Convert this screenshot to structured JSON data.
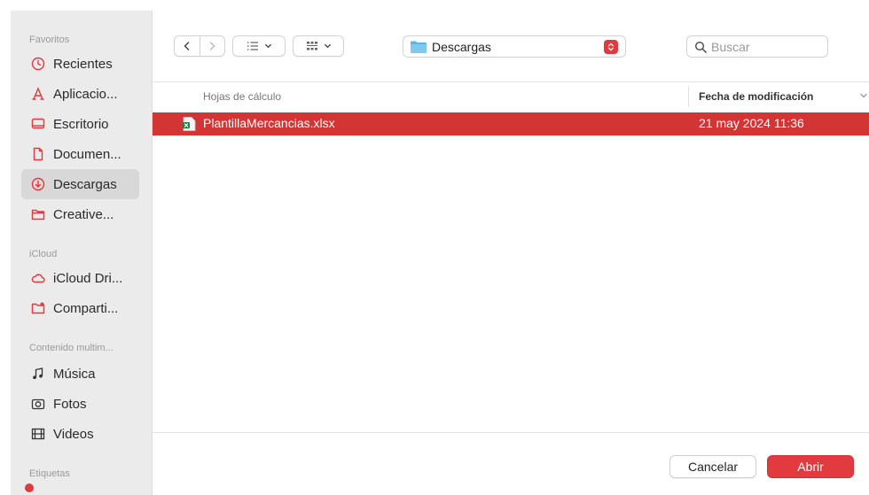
{
  "sidebar": {
    "sections": [
      {
        "title": "Favoritos",
        "items": [
          {
            "label": "Recientes",
            "icon": "clock-icon"
          },
          {
            "label": "Aplicacio...",
            "icon": "applications-icon"
          },
          {
            "label": "Escritorio",
            "icon": "desktop-icon"
          },
          {
            "label": "Documen...",
            "icon": "document-icon"
          },
          {
            "label": "Descargas",
            "icon": "download-icon",
            "active": true
          },
          {
            "label": "Creative...",
            "icon": "folder-icon"
          }
        ]
      },
      {
        "title": "iCloud",
        "items": [
          {
            "label": "iCloud Dri...",
            "icon": "cloud-icon"
          },
          {
            "label": "Comparti...",
            "icon": "shared-folder-icon"
          }
        ]
      },
      {
        "title": "Contenido multim...",
        "items": [
          {
            "label": "Música",
            "icon": "music-icon"
          },
          {
            "label": "Fotos",
            "icon": "camera-icon"
          },
          {
            "label": "Videos",
            "icon": "film-icon"
          }
        ]
      },
      {
        "title": "Etiquetas",
        "items": []
      }
    ]
  },
  "toolbar": {
    "location": "Descargas",
    "search_placeholder": "Buscar"
  },
  "list": {
    "col_name": "Hojas de cálculo",
    "col_date": "Fecha de modificación",
    "rows": [
      {
        "name": "PlantillaMercancias.xlsx",
        "date": "21 may 2024 11:36",
        "selected": true
      }
    ]
  },
  "buttons": {
    "cancel": "Cancelar",
    "open": "Abrir"
  },
  "colors": {
    "accent": "#e13b3f",
    "selection": "#d33434",
    "sidebar_bg": "#ebebeb"
  }
}
